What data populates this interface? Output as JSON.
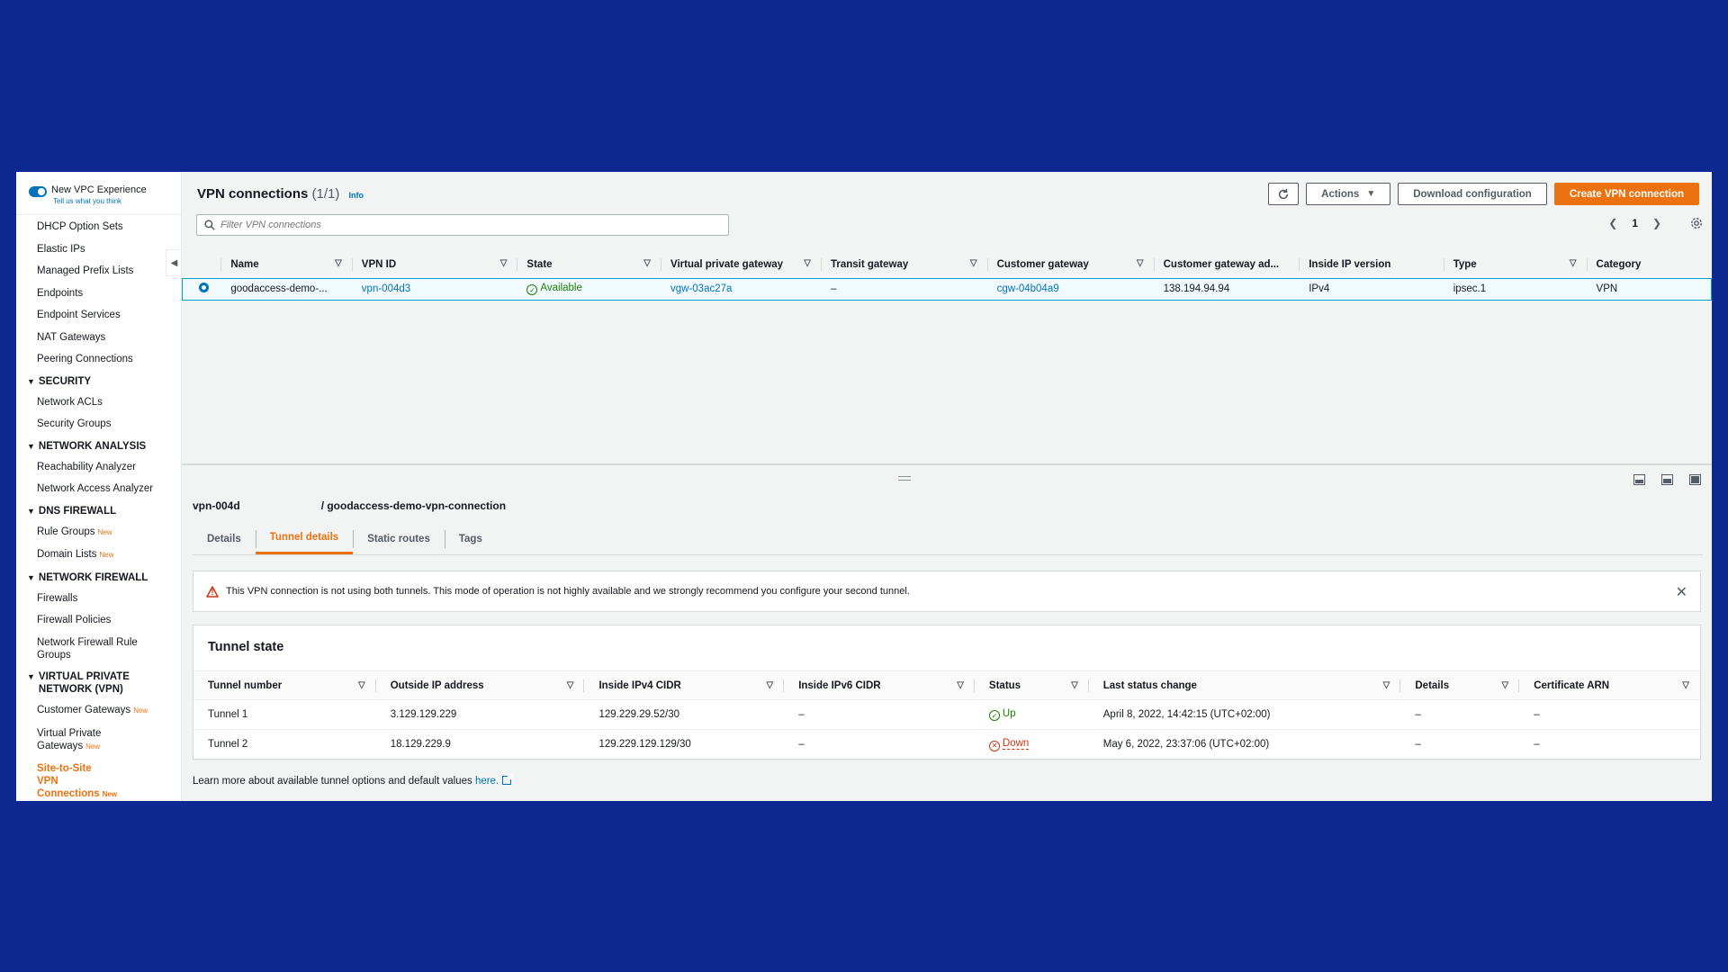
{
  "sidebar": {
    "toggle_title": "New VPC Experience",
    "toggle_sub": "Tell us what you think",
    "top_items": [
      "DHCP Option Sets",
      "Elastic IPs",
      "Managed Prefix Lists",
      "Endpoints",
      "Endpoint Services",
      "NAT Gateways",
      "Peering Connections"
    ],
    "security": {
      "title": "SECURITY",
      "items": [
        "Network ACLs",
        "Security Groups"
      ]
    },
    "network_analysis": {
      "title": "NETWORK ANALYSIS",
      "items": [
        "Reachability Analyzer",
        "Network Access Analyzer"
      ]
    },
    "dns_firewall": {
      "title": "DNS FIREWALL",
      "items": [
        "Rule Groups",
        "Domain Lists"
      ]
    },
    "network_firewall": {
      "title": "NETWORK FIREWALL",
      "items": [
        "Firewalls",
        "Firewall Policies",
        "Network Firewall Rule Groups"
      ]
    },
    "vpn": {
      "title": "VIRTUAL PRIVATE NETWORK (VPN)",
      "items": [
        "Customer Gateways",
        "Virtual Private Gateways",
        "Site-to-Site VPN Connections"
      ]
    },
    "new_badge": "New"
  },
  "header": {
    "title": "VPN connections",
    "count": "(1/1)",
    "info": "Info",
    "actions": "Actions",
    "download": "Download configuration",
    "create": "Create VPN connection",
    "search_placeholder": "Filter VPN connections",
    "page": "1"
  },
  "vpn_table": {
    "columns": [
      "Name",
      "VPN ID",
      "State",
      "Virtual private gateway",
      "Transit gateway",
      "Customer gateway",
      "Customer gateway ad...",
      "Inside IP version",
      "Type",
      "Category"
    ],
    "row": {
      "name": "goodaccess-demo-...",
      "vpn_id": "vpn-004d3",
      "state": "Available",
      "vgw": "vgw-03ac27a",
      "tgw": "–",
      "cgw": "cgw-04b04a9",
      "cgw_addr": "138.194.94.94",
      "ip_version": "IPv4",
      "type": "ipsec.1",
      "category": "VPN"
    }
  },
  "detail": {
    "id": "vpn-004d",
    "path": "/ goodaccess-demo-vpn-connection",
    "tabs": [
      "Details",
      "Tunnel details",
      "Static routes",
      "Tags"
    ],
    "alert": "This VPN connection is not using both tunnels. This mode of operation is not highly available and we strongly recommend you configure your second tunnel.",
    "tunnel_title": "Tunnel state",
    "tunnel_columns": [
      "Tunnel number",
      "Outside IP address",
      "Inside IPv4 CIDR",
      "Inside IPv6 CIDR",
      "Status",
      "Last status change",
      "Details",
      "Certificate ARN"
    ],
    "tunnels": [
      {
        "number": "Tunnel 1",
        "outside_ip": "3.129.129.229",
        "ipv4": "129.229.29.52/30",
        "ipv6": "–",
        "status": "Up",
        "last_change": "April 8, 2022, 14:42:15 (UTC+02:00)",
        "details": "–",
        "arn": "–"
      },
      {
        "number": "Tunnel 2",
        "outside_ip": "18.129.229.9",
        "ipv4": "129.229.129.129/30",
        "ipv6": "–",
        "status": "Down",
        "last_change": "May 6, 2022, 23:37:06 (UTC+02:00)",
        "details": "–",
        "arn": "–"
      }
    ],
    "learn_text": "Learn more about available tunnel options and default values",
    "learn_link": "here."
  }
}
